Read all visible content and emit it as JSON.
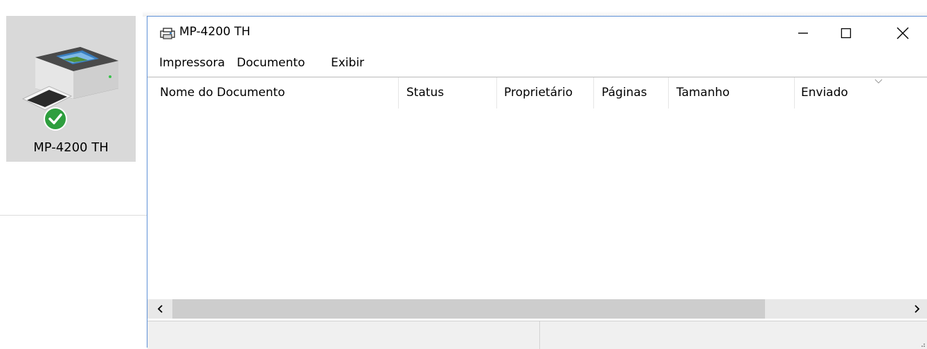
{
  "desktop": {
    "printer_label": "MP-4200 TH",
    "printer_icon": "printer-icon",
    "status_icon": "green-check-icon"
  },
  "window": {
    "title": "MP-4200 TH",
    "title_icon": "printer-small-icon",
    "controls": {
      "minimize": "minimize-icon",
      "maximize": "maximize-icon",
      "close": "close-icon"
    },
    "menu": [
      "Impressora",
      "Documento",
      "Exibir"
    ],
    "columns": [
      "Nome do Documento",
      "Status",
      "Proprietário",
      "Páginas",
      "Tamanho",
      "Enviado"
    ],
    "rows": [],
    "scrollbar": {
      "left_icon": "chevron-left-icon",
      "right_icon": "chevron-right-icon"
    },
    "status": [
      "",
      ""
    ]
  },
  "colors": {
    "window_border": "#5c8fd6",
    "tile_bg": "#d9d9d9",
    "check_green": "#2e9e3e",
    "statusbar_bg": "#f0f0f0"
  }
}
